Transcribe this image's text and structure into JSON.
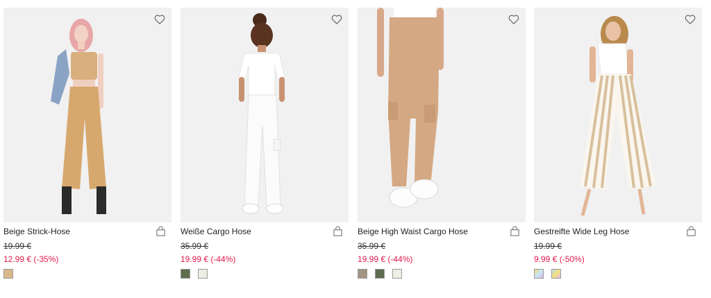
{
  "products": [
    {
      "title": "Beige Strick-Hose",
      "old_price": "19.99 €",
      "new_price": "12.99 € (-35%)",
      "swatches": [
        {
          "color": "#d9b88b"
        }
      ],
      "wishlist_icon": "heart-outline-icon",
      "bag_icon": "shopping-bag-icon"
    },
    {
      "title": "Weiße Cargo Hose",
      "old_price": "35.99 €",
      "new_price": "19.99 € (-44%)",
      "swatches": [
        {
          "color": "#5e6b4e"
        },
        {
          "color": "#efeee2"
        }
      ],
      "wishlist_icon": "heart-outline-icon",
      "bag_icon": "shopping-bag-icon"
    },
    {
      "title": "Beige High Waist Cargo Hose",
      "old_price": "35.99 €",
      "new_price": "19.99 € (-44%)",
      "swatches": [
        {
          "color": "#a49484"
        },
        {
          "color": "#5f6b4f"
        },
        {
          "color": "#f0efe3"
        }
      ],
      "wishlist_icon": "heart-outline-icon",
      "bag_icon": "shopping-bag-icon"
    },
    {
      "title": "Gestreifte Wide Leg Hose",
      "old_price": "19.99 €",
      "new_price": "9.99 € (-50%)",
      "swatches": [
        {
          "color": "multicolor"
        },
        {
          "color": "multicolor"
        }
      ],
      "wishlist_icon": "heart-outline-icon",
      "bag_icon": "shopping-bag-icon"
    }
  ],
  "colors": {
    "sale_price": "#e2194b",
    "image_background": "#efefef"
  }
}
